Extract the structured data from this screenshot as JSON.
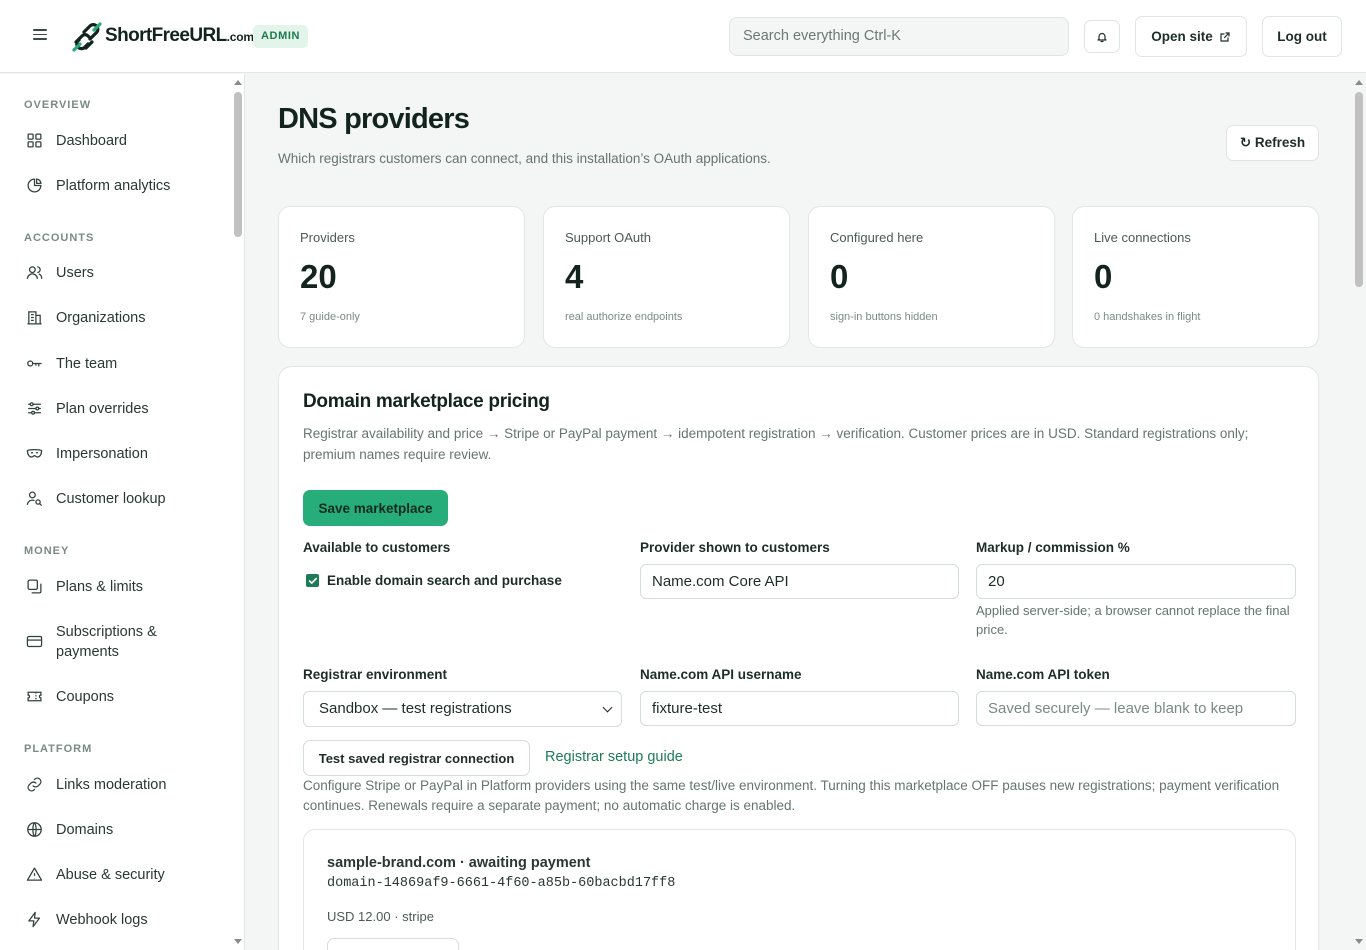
{
  "header": {
    "logo_text": "ShortFree",
    "logo_url_text": "URL",
    "logo_com_text": ".com",
    "admin_badge": "ADMIN",
    "search_placeholder": "Search everything  Ctrl-K",
    "open_site": "Open site",
    "logout": "Log out"
  },
  "sidebar": {
    "sections": [
      {
        "title": "OVERVIEW",
        "items": [
          {
            "label": "Dashboard",
            "icon": "grid-icon"
          },
          {
            "label": "Platform analytics",
            "icon": "pie-chart-icon"
          }
        ]
      },
      {
        "title": "ACCOUNTS",
        "items": [
          {
            "label": "Users",
            "icon": "users-icon"
          },
          {
            "label": "Organizations",
            "icon": "building-icon"
          },
          {
            "label": "The team",
            "icon": "key-icon"
          },
          {
            "label": "Plan overrides",
            "icon": "sliders-icon"
          },
          {
            "label": "Impersonation",
            "icon": "mask-icon"
          },
          {
            "label": "Customer lookup",
            "icon": "user-search-icon"
          }
        ]
      },
      {
        "title": "MONEY",
        "items": [
          {
            "label": "Plans & limits",
            "icon": "copy-icon"
          },
          {
            "label": "Subscriptions & payments",
            "icon": "credit-card-icon"
          },
          {
            "label": "Coupons",
            "icon": "ticket-icon"
          }
        ]
      },
      {
        "title": "PLATFORM",
        "items": [
          {
            "label": "Links moderation",
            "icon": "link-icon"
          },
          {
            "label": "Domains",
            "icon": "globe-icon"
          },
          {
            "label": "Abuse & security",
            "icon": "warning-icon"
          },
          {
            "label": "Webhook logs",
            "icon": "bolt-icon"
          }
        ]
      }
    ]
  },
  "page": {
    "title": "DNS providers",
    "subtitle": "Which registrars customers can connect, and this installation’s OAuth applications.",
    "refresh": "↻ Refresh"
  },
  "stats": [
    {
      "label": "Providers",
      "value": "20",
      "note": "7 guide-only"
    },
    {
      "label": "Support OAuth",
      "value": "4",
      "note": "real authorize endpoints"
    },
    {
      "label": "Configured here",
      "value": "0",
      "note": "sign-in buttons hidden"
    },
    {
      "label": "Live connections",
      "value": "0",
      "note": "0 handshakes in flight"
    }
  ],
  "marketplace": {
    "title": "Domain marketplace pricing",
    "description": "Registrar availability and price → Stripe or PayPal payment → idempotent registration → verification. Customer prices are in USD. Standard registrations only; premium names require review.",
    "save_button": "Save marketplace",
    "available_label": "Available to customers",
    "enable_label": "Enable domain search and purchase",
    "enable_checked": true,
    "provider_label": "Provider shown to customers",
    "provider_value": "Name.com Core API",
    "markup_label": "Markup / commission %",
    "markup_value": "20",
    "markup_help": "Applied server-side; a browser cannot replace the final price.",
    "env_label": "Registrar environment",
    "env_value": "Sandbox — test registrations",
    "username_label": "Name.com API username",
    "username_value": "fixture-test",
    "token_label": "Name.com API token",
    "token_placeholder": "Saved securely — leave blank to keep",
    "test_button": "Test saved registrar connection",
    "guide_link": "Registrar setup guide",
    "config_note": "Configure Stripe or PayPal in Platform providers using the same test/live environment. Turning this marketplace OFF pauses new registrations; payment verification continues. Renewals require a separate payment; no automatic charge is enabled."
  },
  "order": {
    "title": "sample-brand.com · awaiting payment",
    "id": "domain-14869af9-6661-4f60-a85b-60bacbd17ff8",
    "meta": "USD 12.00 · stripe"
  },
  "colors": {
    "accent": "#26ad7a",
    "link": "#1d7b57",
    "badge_bg": "#e3f4ea"
  }
}
